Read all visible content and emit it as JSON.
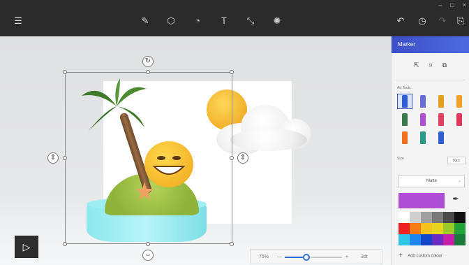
{
  "toolbar": {
    "menu_icon": "hamburger-menu-icon",
    "tools": [
      {
        "name": "brushes",
        "icon": "brush-icon",
        "glyph": "✎"
      },
      {
        "name": "3d-shapes",
        "icon": "cube-icon",
        "glyph": "⬡"
      },
      {
        "name": "stickers",
        "icon": "sticker-icon",
        "glyph": "◔"
      },
      {
        "name": "text",
        "icon": "text-icon",
        "glyph": "T"
      },
      {
        "name": "canvas",
        "icon": "crop-icon",
        "glyph": "⤡"
      },
      {
        "name": "effects",
        "icon": "sun-icon",
        "glyph": "✺"
      }
    ],
    "right_icons": [
      {
        "name": "undo",
        "icon": "undo-icon",
        "glyph": "↶"
      },
      {
        "name": "history",
        "icon": "history-icon",
        "glyph": "◷"
      },
      {
        "name": "redo",
        "icon": "redo-icon",
        "glyph": "↷"
      },
      {
        "name": "paste",
        "icon": "paste-icon",
        "glyph": "⎘"
      }
    ],
    "window_buttons": [
      "–",
      "□",
      "×"
    ]
  },
  "panel": {
    "title": "Marker",
    "section_label": "Art Tools",
    "size_label": "Size",
    "size_value": "50px",
    "finish": "Matte",
    "selected_color": "#b04fd6",
    "add_color_label": "Add custom colour",
    "tools": [
      {
        "icon": "marker-icon",
        "color": "#2f5fd0",
        "selected": true
      },
      {
        "icon": "calligraphy-pen-icon",
        "color": "#6b6bd6"
      },
      {
        "icon": "oil-brush-icon",
        "color": "#e0a020"
      },
      {
        "icon": "watercolor-icon",
        "color": "#f0a028"
      },
      {
        "icon": "pixel-pen-icon",
        "color": "#3a7a4a"
      },
      {
        "icon": "pencil-icon",
        "color": "#b050d0"
      },
      {
        "icon": "eraser-icon",
        "color": "#e04060"
      },
      {
        "icon": "crayon-icon",
        "color": "#e0365a"
      },
      {
        "icon": "spray-can-icon",
        "color": "#f07020"
      },
      {
        "icon": "fill-bucket-icon",
        "color": "#2a9a8a"
      },
      {
        "icon": "line-icon",
        "color": "#2f5fd0"
      }
    ],
    "palette": [
      "#ffffff",
      "#cfcfcf",
      "#a0a0a0",
      "#7a7a7a",
      "#4a4a4a",
      "#111111",
      "#ee2222",
      "#f57b12",
      "#f4c21a",
      "#e8d61e",
      "#9acb2a",
      "#22a33a",
      "#2bc6e8",
      "#1c86ee",
      "#1245c8",
      "#6b2ac2",
      "#c61ea8",
      "#1a7a3a"
    ]
  },
  "zoom": {
    "value_label": "75%",
    "minus": "—",
    "plus": "+",
    "fit_label": "3dt",
    "level": 0.38
  },
  "play_icon": "play-icon"
}
